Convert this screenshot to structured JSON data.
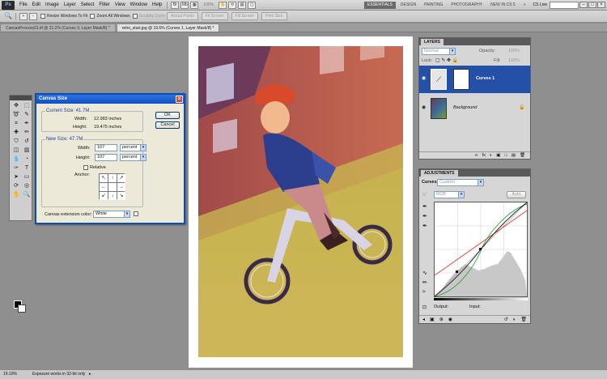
{
  "app": {
    "logo_text": "Ps"
  },
  "menu": [
    "File",
    "Edit",
    "Image",
    "Layer",
    "Select",
    "Filter",
    "View",
    "Window",
    "Help"
  ],
  "menubar_zoom": "100%",
  "workspaces": [
    "Essentials",
    "Design",
    "Painting",
    "Photography",
    "New in CS 5"
  ],
  "workspace_more": "»",
  "cs_live": "CS Live",
  "options_bar": {
    "resize_windows": "Resize Windows To Fit",
    "zoom_all": "Zoom All Windows",
    "scrubby_zoom": "Scrubby Zoom",
    "actual_pixels": "Actual Pixels",
    "fit_screen": "Fit Screen",
    "fill_screen": "Fill Screen",
    "print_size": "Print Size"
  },
  "tabs": [
    {
      "label": "CanvasProcess01.tif @ 21.2% (Curves 3, Layer Mask/8) *",
      "active": false
    },
    {
      "label": "retro_start.jpg @ 19.6% (Curves 1, Layer Mask/8) *",
      "active": true
    }
  ],
  "dialog": {
    "title": "Canvas Size",
    "current_size_label": "Current Size: 41.7M",
    "current_width_label": "Width:",
    "current_width": "12.983 inches",
    "current_height_label": "Height:",
    "current_height": "19.475 inches",
    "new_size_label": "New Size: 47.7M",
    "width_label": "Width:",
    "width_value": "107",
    "width_unit": "percent",
    "height_label": "Height:",
    "height_value": "107",
    "height_unit": "percent",
    "relative_label": "Relative",
    "anchor_label": "Anchor:",
    "anchor_arrows": [
      "↖",
      "↑",
      "↗",
      "←",
      "",
      "→",
      "↙",
      "↓",
      "↘"
    ],
    "extension_label": "Canvas extension color:",
    "extension_value": "White",
    "ok": "OK",
    "cancel": "Cancel"
  },
  "layers_panel": {
    "tab": "LAYERS",
    "blend_mode": "Normal",
    "opacity_label": "Opacity:",
    "opacity_value": "100%",
    "lock_label": "Lock:",
    "fill_label": "Fill:",
    "fill_value": "100%",
    "layers": [
      {
        "name": "Curves 1",
        "selected": true
      },
      {
        "name": "Background",
        "selected": false
      }
    ],
    "footer_icons": [
      "fx",
      "◐",
      "▣",
      "□",
      "▤",
      "🗑"
    ]
  },
  "adjustments_panel": {
    "tab": "ADJUSTMENTS",
    "type_label": "Curves",
    "preset": "Custom",
    "channel": "RGB",
    "auto": "Auto",
    "output_label": "Output:",
    "input_label": "Input:"
  },
  "status": {
    "zoom": "19.19%",
    "message": "Exposure works in 32-bit only"
  },
  "colors": {
    "selection_blue": "#2450a8",
    "red_curve": "#e03a2a",
    "green_curve": "#2f9a3a",
    "dialog_title": "#0d4fc4"
  },
  "icons": [
    "zoom-tool-icon",
    "hand-icon",
    "eye-icon",
    "lock-icon",
    "close-icon"
  ]
}
